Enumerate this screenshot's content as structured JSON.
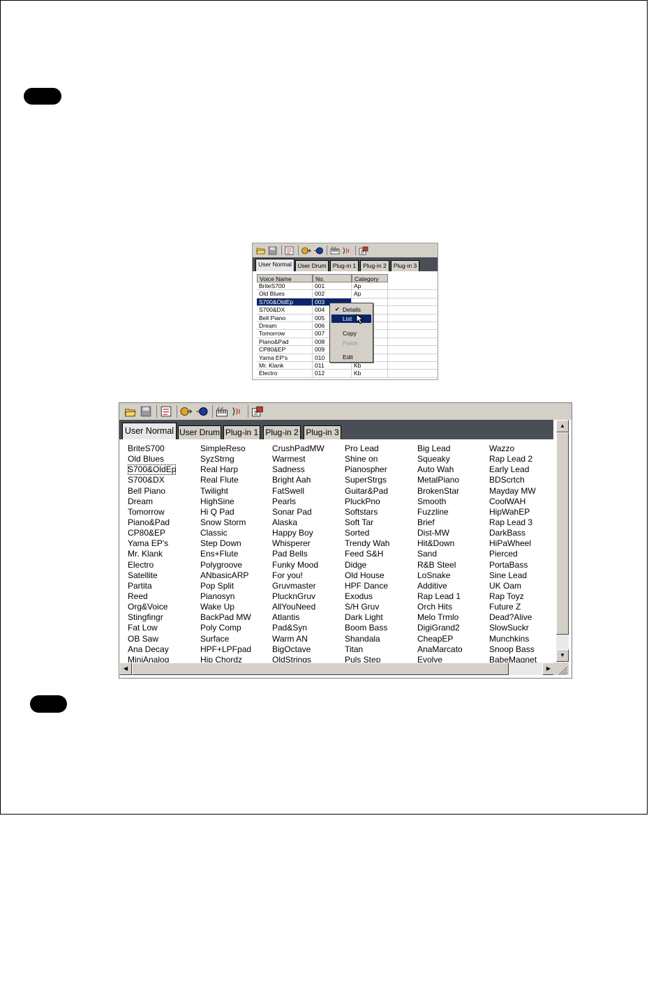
{
  "small_window": {
    "tabs": [
      {
        "label": "User Normal",
        "active": true
      },
      {
        "label": "User Drum",
        "active": false
      },
      {
        "label": "Plug-in 1",
        "active": false
      },
      {
        "label": "Plug-in 2",
        "active": false
      },
      {
        "label": "Plug-in 3",
        "active": false
      }
    ],
    "columns": [
      "Voice Name",
      "No.",
      "Category"
    ],
    "rows": [
      {
        "name": "BriteS700",
        "no": "001",
        "cat": "Ap"
      },
      {
        "name": "Old Blues",
        "no": "002",
        "cat": "Ap"
      },
      {
        "name": "S700&OldEp",
        "no": "003",
        "cat": "",
        "selected": true
      },
      {
        "name": "S700&DX",
        "no": "004",
        "cat": ""
      },
      {
        "name": "Bell Piano",
        "no": "005",
        "cat": ""
      },
      {
        "name": "Dream",
        "no": "006",
        "cat": ""
      },
      {
        "name": "Tomorrow",
        "no": "007",
        "cat": ""
      },
      {
        "name": "Piano&Pad",
        "no": "008",
        "cat": ""
      },
      {
        "name": "CP80&EP",
        "no": "009",
        "cat": ""
      },
      {
        "name": "Yama EP's",
        "no": "010",
        "cat": ""
      },
      {
        "name": "Mr. Klank",
        "no": "011",
        "cat": "Kb"
      },
      {
        "name": "Electro",
        "no": "012",
        "cat": "Kb"
      }
    ],
    "context_menu": {
      "details": "Details",
      "list": "List",
      "copy": "Copy",
      "paste": "Paste",
      "edit": "Edit"
    }
  },
  "big_window": {
    "tabs": [
      {
        "label": "User Normal",
        "active": true
      },
      {
        "label": "User Drum",
        "active": false
      },
      {
        "label": "Plug-in 1",
        "active": false
      },
      {
        "label": "Plug-in 2",
        "active": false
      },
      {
        "label": "Plug-in 3",
        "active": false
      }
    ],
    "columns": [
      [
        "BriteS700",
        "Old Blues",
        "S700&OldEp",
        "S700&DX",
        "Bell Piano",
        "Dream",
        "Tomorrow",
        "Piano&Pad",
        "CP80&EP",
        "Yama EP's",
        "Mr. Klank",
        "Electro",
        "Satellite",
        "Partita",
        "Reed",
        "Org&Voice",
        "Stingfingr",
        "Fat Low",
        "OB Saw",
        "Ana Decay",
        "MiniAnalog"
      ],
      [
        "SimpleReso",
        "SyzStrng",
        "Real Harp",
        "Real Flute",
        "Twilight",
        "HighSine",
        "Hi Q Pad",
        "Snow Storm",
        "Classic",
        "Step Down",
        "Ens+Flute",
        "Polygroove",
        "ANbasicARP",
        "Pop Split",
        "Pianosyn",
        "Wake Up",
        "BackPad MW",
        "Poly Comp",
        "Surface",
        "HPF+LPFpad",
        "Hip Chordz"
      ],
      [
        "CrushPadMW",
        "Warmest",
        "Sadness",
        "Bright Aah",
        "FatSwell",
        "Pearls",
        "Sonar Pad",
        "Alaska",
        "Happy Boy",
        "Whisperer",
        "Pad Bells",
        "Funky Mood",
        "For you!",
        "Gruvmaster",
        "PlucknGruv",
        "AllYouNeed",
        "Atlantis",
        "Pad&Syn",
        "Warm AN",
        "BigOctave",
        "OldStrings"
      ],
      [
        "Pro Lead",
        "Shine on",
        "Pianospher",
        "SuperStrgs",
        "Guitar&Pad",
        "PluckPno",
        "Softstars",
        "Soft Tar",
        "Sorted",
        "Trendy Wah",
        "Feed S&H",
        "Didge",
        "Old House",
        "HPF Dance",
        "Exodus",
        "S/H Gruv",
        "Dark Light",
        "Boom Bass",
        "Shandala",
        "Titan",
        "Puls Step"
      ],
      [
        "Big Lead",
        "Squeaky",
        "Auto Wah",
        "MetalPiano",
        "BrokenStar",
        "Smooth",
        "Fuzzline",
        "Brief",
        "Dist-MW",
        "Hit&Down",
        "Sand",
        "R&B Steel",
        "LoSnake",
        "Additive",
        "Rap Lead 1",
        "Orch Hits",
        "Melo Trmlo",
        "DigiGrand2",
        "CheapEP",
        "AnaMarcato",
        "Evolve"
      ],
      [
        "Wazzo",
        "Rap Lead 2",
        "Early Lead",
        "BDScrtch",
        "Mayday MW",
        "CoolWAH",
        "HipWahEP",
        "Rap Lead 3",
        "DarkBass",
        "HiPaWheel",
        "Pierced",
        "PortaBass",
        "Sine Lead",
        "UK Oam",
        "Rap Toyz",
        "Future Z",
        "Dead?Alive",
        "SlowSuckr",
        "Munchkins",
        "Snoop Bass",
        "BabeMagnet"
      ]
    ],
    "focused_item": "S700&OldEp"
  }
}
